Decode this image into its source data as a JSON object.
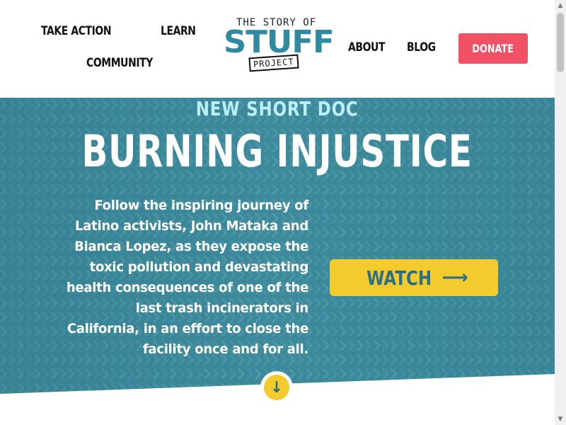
{
  "nav": {
    "take_action": "TAKE ACTION",
    "learn": "LEARN",
    "community": "COMMUNITY",
    "about": "ABOUT",
    "blog": "BLOG",
    "donate": "DONATE"
  },
  "logo": {
    "line1": "THE STORY OF",
    "line2": "STUFF",
    "line3": "PROJECT"
  },
  "hero": {
    "eyebrow": "NEW SHORT DOC",
    "title": "BURNING INJUSTICE",
    "description_lines": [
      "Follow the inspiring journey of",
      "Latino activists, John Mataka and",
      "Bianca Lopez, as they expose the",
      "toxic pollution and devastating",
      "health consequences of one of the",
      "last trash incinerators in",
      "California, in an effort to close the",
      "facility once and for all."
    ],
    "watch_label": "WATCH",
    "watch_arrow": "⟶",
    "down_arrow": "↓"
  },
  "colors": {
    "hero_teal": "#3c8a9c",
    "accent_yellow": "#f4cb2d",
    "donate_red": "#f05165",
    "eyebrow_light": "#bdeff7",
    "logo_teal": "#2f8aa0"
  },
  "icons": {
    "watch_arrow": "arrow-right-icon",
    "scroll_down": "arrow-down-icon"
  }
}
